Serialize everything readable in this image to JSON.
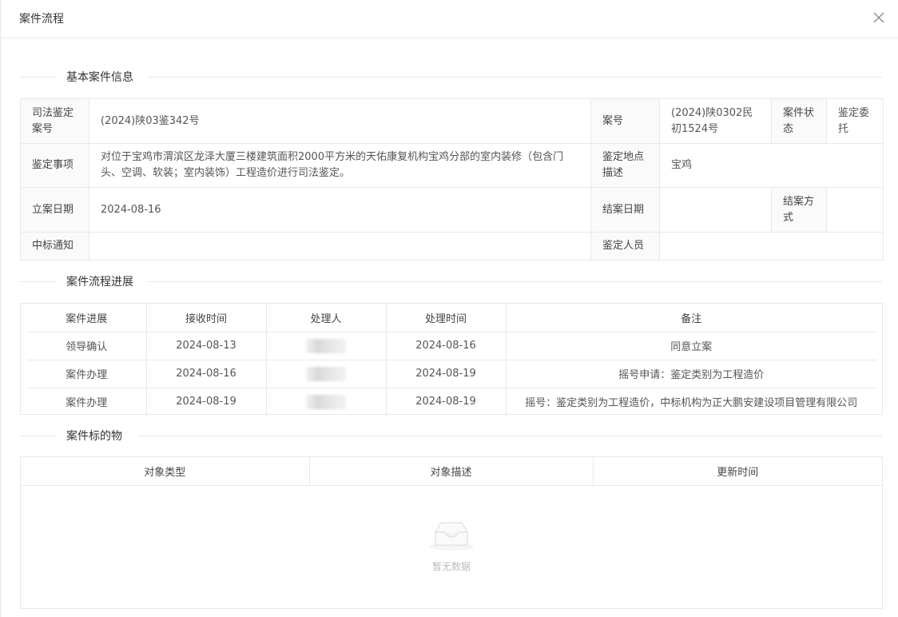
{
  "modal": {
    "title": "案件流程"
  },
  "sections": {
    "basic_info": "基本案件信息",
    "progress": "案件流程进展",
    "subject": "案件标的物"
  },
  "basic_info": {
    "judicial_appraisal_no_label": "司法鉴定案号",
    "judicial_appraisal_no": "(2024)陕03鉴342号",
    "case_no_label": "案号",
    "case_no": "(2024)陕0302民初1524号",
    "case_status_label": "案件状态",
    "case_status": "鉴定委托",
    "appraisal_matter_label": "鉴定事项",
    "appraisal_matter": "对位于宝鸡市渭滨区龙泽大厦三楼建筑面积2000平方米的天佑康复机构宝鸡分部的室内装修（包含门头、空调、软装；室内装饰）工程造价进行司法鉴定。",
    "location_label": "鉴定地点描述",
    "location": "宝鸡",
    "filing_date_label": "立案日期",
    "filing_date": "2024-08-16",
    "closing_date_label": "结案日期",
    "closing_date": "",
    "closing_method_label": "结案方式",
    "closing_method": "",
    "bid_notice_label": "中标通知",
    "bid_notice": "",
    "appraiser_label": "鉴定人员",
    "appraiser": ""
  },
  "progress": {
    "headers": [
      "案件进展",
      "接收时间",
      "处理人",
      "处理时间",
      "备注"
    ],
    "rows": [
      {
        "stage": "领导确认",
        "received": "2024-08-13",
        "handler": "",
        "handled": "2024-08-16",
        "note": "同意立案"
      },
      {
        "stage": "案件办理",
        "received": "2024-08-16",
        "handler": "",
        "handled": "2024-08-19",
        "note": "摇号申请：鉴定类别为工程造价"
      },
      {
        "stage": "案件办理",
        "received": "2024-08-19",
        "handler": "",
        "handled": "2024-08-19",
        "note": "摇号：鉴定类别为工程造价，中标机构为正大鹏安建设项目管理有限公司"
      }
    ]
  },
  "subject": {
    "headers": [
      "对象类型",
      "对象描述",
      "更新时间"
    ],
    "empty_text": "暂无数据"
  }
}
